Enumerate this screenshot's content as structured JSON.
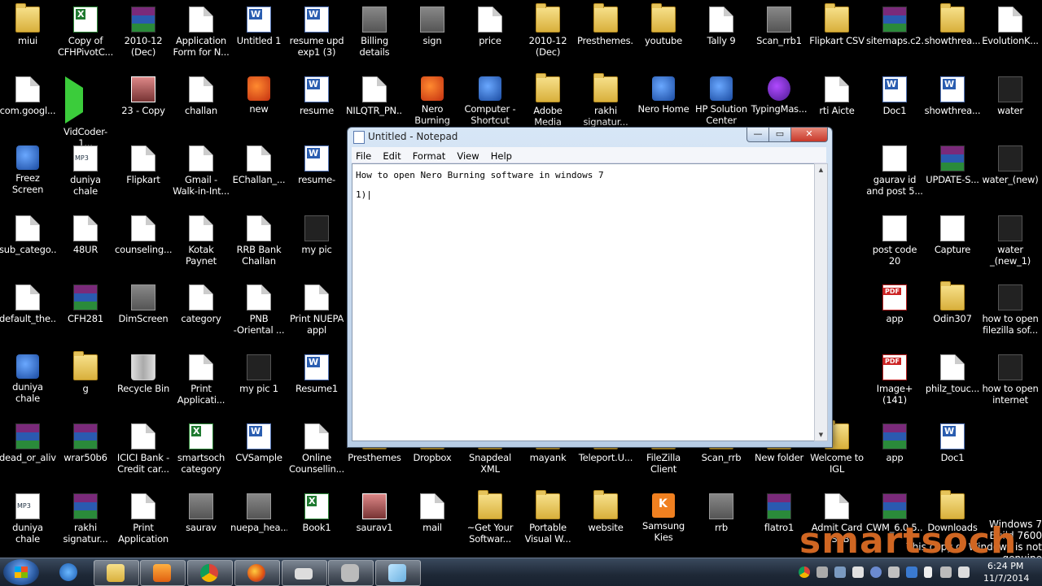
{
  "desktop": {
    "icons": [
      {
        "label": "miui",
        "type": "folder"
      },
      {
        "label": "Copy of\nCFHPivotC...",
        "type": "excel"
      },
      {
        "label": "2010-12\n(Dec)",
        "type": "rar"
      },
      {
        "label": "Application\nForm for N...",
        "type": "doc"
      },
      {
        "label": "Untitled 1",
        "type": "word"
      },
      {
        "label": "resume upd\nexp1 (3)",
        "type": "word"
      },
      {
        "label": "Billing details",
        "type": "img"
      },
      {
        "label": "sign",
        "type": "img"
      },
      {
        "label": "price",
        "type": "doc"
      },
      {
        "label": "2010-12\n(Dec)",
        "type": "folder"
      },
      {
        "label": "Presthemes...",
        "type": "folder"
      },
      {
        "label": "youtube",
        "type": "folder"
      },
      {
        "label": "Tally 9",
        "type": "doc"
      },
      {
        "label": "Scan_rrb1",
        "type": "img"
      },
      {
        "label": "Flipkart CSV",
        "type": "folder"
      },
      {
        "label": "sitemaps.c2...",
        "type": "rar"
      },
      {
        "label": "showthrea...",
        "type": "folder"
      },
      {
        "label": "EvolutionK...",
        "type": "doc"
      },
      {
        "label": "com.googl...",
        "type": "doc"
      },
      {
        "label": "VidCoder-1...",
        "type": "green"
      },
      {
        "label": "23 - Copy",
        "type": "pic"
      },
      {
        "label": "challan",
        "type": "doc"
      },
      {
        "label": "new",
        "type": "app"
      },
      {
        "label": "resume",
        "type": "word"
      },
      {
        "label": "NILQTR_PN...",
        "type": "doc"
      },
      {
        "label": "Nero Burning\nROM",
        "type": "app"
      },
      {
        "label": "Computer -\nShortcut",
        "type": "blue"
      },
      {
        "label": "Adobe Media\nEncoder CS...",
        "type": "folder"
      },
      {
        "label": "rakhi\nsignatur...",
        "type": "folder"
      },
      {
        "label": "Nero Home",
        "type": "blue"
      },
      {
        "label": "HP Solution\nCenter",
        "type": "blue"
      },
      {
        "label": "TypingMas...",
        "type": "purple"
      },
      {
        "label": "rti Aicte",
        "type": "doc"
      },
      {
        "label": "Doc1",
        "type": "word"
      },
      {
        "label": "showthrea...",
        "type": "word"
      },
      {
        "label": "water",
        "type": "dark"
      },
      {
        "label": "Freez Screen\nVideo Cap...",
        "type": "blue"
      },
      {
        "label": "duniya chale\nna shri ra...",
        "type": "mp3"
      },
      {
        "label": "Flipkart",
        "type": "doc"
      },
      {
        "label": "Gmail -\nWalk-in-Int...",
        "type": "doc"
      },
      {
        "label": "EChallan_...",
        "type": "doc"
      },
      {
        "label": "resume-",
        "type": "word"
      },
      {
        "label": "gaurav id\nand post 5...",
        "type": "note"
      },
      {
        "label": "UPDATE-S...",
        "type": "rar"
      },
      {
        "label": "water_(new)",
        "type": "dark"
      },
      {
        "label": "sub_catego...",
        "type": "doc"
      },
      {
        "label": "48UR",
        "type": "doc"
      },
      {
        "label": "counseling...",
        "type": "doc"
      },
      {
        "label": "Kotak Paynet",
        "type": "doc"
      },
      {
        "label": "RRB Bank\nChallan",
        "type": "doc"
      },
      {
        "label": "my pic",
        "type": "dark"
      },
      {
        "label": "post code 20",
        "type": "note"
      },
      {
        "label": "Capture",
        "type": "note"
      },
      {
        "label": "water\n_(new_1)",
        "type": "dark"
      },
      {
        "label": "default_the...",
        "type": "doc"
      },
      {
        "label": "CFH281",
        "type": "rar"
      },
      {
        "label": "DimScreen",
        "type": "img"
      },
      {
        "label": "category",
        "type": "doc"
      },
      {
        "label": "PNB\n-Oriental ...",
        "type": "doc"
      },
      {
        "label": "Print NUEPA\nappl",
        "type": "doc"
      },
      {
        "label": "app",
        "type": "pdf"
      },
      {
        "label": "Odin307",
        "type": "folder"
      },
      {
        "label": "how to open\nfilezilla sof...",
        "type": "dark"
      },
      {
        "label": "duniya chale\nna shri ra...",
        "type": "blue"
      },
      {
        "label": "g",
        "type": "folder"
      },
      {
        "label": "Recycle Bin",
        "type": "bin"
      },
      {
        "label": "Print\nApplicati...",
        "type": "doc"
      },
      {
        "label": "my pic 1",
        "type": "dark"
      },
      {
        "label": "Resume1",
        "type": "word"
      },
      {
        "label": "Image+(141)",
        "type": "pdf"
      },
      {
        "label": "philz_touc...",
        "type": "doc"
      },
      {
        "label": "how to open\ninternet ex...",
        "type": "dark"
      },
      {
        "label": "dead_or_alive",
        "type": "rar"
      },
      {
        "label": "wrar50b6",
        "type": "rar"
      },
      {
        "label": "ICICI Bank -\nCredit car...",
        "type": "doc"
      },
      {
        "label": "smartsoch\ncategory",
        "type": "excel"
      },
      {
        "label": "CVSample",
        "type": "word"
      },
      {
        "label": "Online\nCounsellin...",
        "type": "doc"
      },
      {
        "label": "Presthemes",
        "type": "folder"
      },
      {
        "label": "Dropbox",
        "type": "folder"
      },
      {
        "label": "Snapdeal\nXML",
        "type": "folder"
      },
      {
        "label": "mayank",
        "type": "folder"
      },
      {
        "label": "Teleport.U...",
        "type": "folder"
      },
      {
        "label": "FileZilla\nClient",
        "type": "folder"
      },
      {
        "label": "Scan_rrb",
        "type": "folder"
      },
      {
        "label": "New folder",
        "type": "folder"
      },
      {
        "label": "Welcome to\nIGL",
        "type": "folder"
      },
      {
        "label": "app",
        "type": "rar"
      },
      {
        "label": "Doc1",
        "type": "word"
      },
      {
        "label": "duniya chale",
        "type": "mp3"
      },
      {
        "label": "rakhi\nsignatur...",
        "type": "rar"
      },
      {
        "label": "Print\nApplication",
        "type": "doc"
      },
      {
        "label": "saurav",
        "type": "img"
      },
      {
        "label": "nuepa_hea...",
        "type": "img"
      },
      {
        "label": "Book1",
        "type": "excel"
      },
      {
        "label": "saurav1",
        "type": "pic"
      },
      {
        "label": "mail",
        "type": "doc"
      },
      {
        "label": "~Get Your\nSoftwar...",
        "type": "folder"
      },
      {
        "label": "Portable\nVisual W...",
        "type": "folder"
      },
      {
        "label": "website",
        "type": "folder"
      },
      {
        "label": "Samsung\nKies",
        "type": "orange"
      },
      {
        "label": "rrb",
        "type": "img"
      },
      {
        "label": "flatro1",
        "type": "rar"
      },
      {
        "label": "Admit Card\nDSSB",
        "type": "doc"
      },
      {
        "label": "CWM_6.0.5...",
        "type": "rar"
      },
      {
        "label": "Downloads",
        "type": "folder"
      }
    ]
  },
  "notepad": {
    "title": "Untitled - Notepad",
    "menus": [
      "File",
      "Edit",
      "Format",
      "View",
      "Help"
    ],
    "text": "How to open Nero Burning software in windows 7\n1)|",
    "min_label": "—",
    "max_label": "▭",
    "close_label": "✕"
  },
  "taskbar": {
    "clock_time": "6:24 PM",
    "clock_date": "11/7/2014",
    "apps": [
      "Explorer",
      "Internet Explorer",
      "File Manager",
      "Media Player",
      "Chrome",
      "Firefox",
      "Window",
      "Camera",
      "Notepad"
    ]
  },
  "overlay": {
    "windows_version": "Windows 7",
    "build": "Build 7600",
    "genuine_notice": "This copy of Windows is not genuine",
    "watermark": "smartsoch"
  },
  "colors": {
    "desktop_bg": "#000000",
    "notepad_frame": "#b8cde6",
    "close_red": "#c8382a",
    "watermark": "#f57828"
  }
}
